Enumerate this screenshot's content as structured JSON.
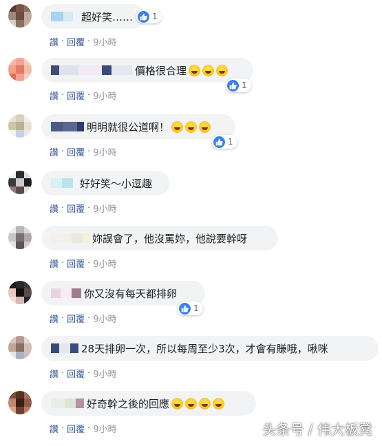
{
  "comments": [
    {
      "text": "超好笑……",
      "emojis": 0,
      "likes": "1",
      "reply": "回覆",
      "like": "讚",
      "time": "9小時"
    },
    {
      "text": "價格很合理",
      "emojis": 3,
      "likes": "1",
      "reply": "回覆",
      "like": "讚",
      "time": "9小時"
    },
    {
      "text": "明明就很公道啊！",
      "emojis": 3,
      "likes": "1",
      "reply": "回覆",
      "like": "讚",
      "time": "9小時"
    },
    {
      "text": "好好笑～小逗趣",
      "emojis": 0,
      "likes": "",
      "reply": "回覆",
      "like": "讚",
      "time": "9小時"
    },
    {
      "text": "妳誤會了，他沒罵妳，他說要幹呀",
      "emojis": 0,
      "likes": "",
      "reply": "回覆",
      "like": "讚",
      "time": "9小時"
    },
    {
      "text": "你又沒有每天都排卵",
      "emojis": 0,
      "likes": "1",
      "reply": "回覆",
      "like": "讚",
      "time": "9小時"
    },
    {
      "text": "28天排卵一次，所以每周至少3次，才會有賺哦，啾咪",
      "emojis": 0,
      "likes": "",
      "reply": "回覆",
      "like": "讚",
      "time": "9小時"
    },
    {
      "text": "好奇幹之後的回應",
      "emojis": 4,
      "likes": "",
      "reply": "回覆",
      "like": "讚",
      "time": "9小時"
    }
  ],
  "watermark": "头条号 / 伟大板凳",
  "colors": {
    "bubble": "#f2f3f5",
    "link": "#385898",
    "like_blue": "#3b82e6"
  }
}
